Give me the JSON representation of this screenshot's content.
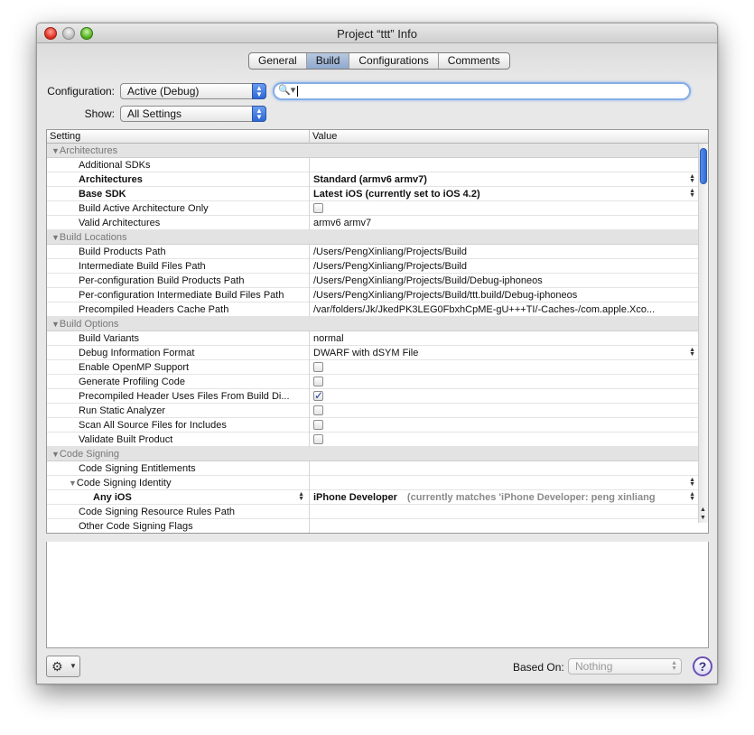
{
  "window": {
    "title": "Project “ttt” Info"
  },
  "tabs": [
    {
      "label": "General"
    },
    {
      "label": "Build",
      "active": true
    },
    {
      "label": "Configurations"
    },
    {
      "label": "Comments"
    }
  ],
  "configuration": {
    "label": "Configuration:",
    "value": "Active (Debug)"
  },
  "show": {
    "label": "Show:",
    "value": "All Settings"
  },
  "search": {
    "value": "",
    "icon": "magnifier-icon"
  },
  "table": {
    "headers": {
      "setting": "Setting",
      "value": "Value"
    },
    "rows": [
      {
        "kind": "group",
        "setting": "Architectures"
      },
      {
        "setting": "Additional SDKs",
        "value": ""
      },
      {
        "setting": "Architectures",
        "value": "Standard (armv6 armv7)",
        "bold": true,
        "stepper": true
      },
      {
        "setting": "Base SDK",
        "value": "Latest iOS (currently set to iOS 4.2)",
        "bold": true,
        "stepper": true
      },
      {
        "setting": "Build Active Architecture Only",
        "checkbox": false
      },
      {
        "setting": "Valid Architectures",
        "value": "armv6 armv7"
      },
      {
        "kind": "group",
        "setting": "Build Locations"
      },
      {
        "setting": "Build Products Path",
        "value": "/Users/PengXinliang/Projects/Build"
      },
      {
        "setting": "Intermediate Build Files Path",
        "value": "/Users/PengXinliang/Projects/Build"
      },
      {
        "setting": "Per-configuration Build Products Path",
        "value": "/Users/PengXinliang/Projects/Build/Debug-iphoneos"
      },
      {
        "setting": "Per-configuration Intermediate Build Files Path",
        "value": "/Users/PengXinliang/Projects/Build/ttt.build/Debug-iphoneos"
      },
      {
        "setting": "Precompiled Headers Cache Path",
        "value": "/var/folders/Jk/JkedPK3LEG0FbxhCpME-gU+++TI/-Caches-/com.apple.Xco..."
      },
      {
        "kind": "group",
        "setting": "Build Options"
      },
      {
        "setting": "Build Variants",
        "value": "normal"
      },
      {
        "setting": "Debug Information Format",
        "value": "DWARF with dSYM File",
        "stepper": true
      },
      {
        "setting": "Enable OpenMP Support",
        "checkbox": false
      },
      {
        "setting": "Generate Profiling Code",
        "checkbox": false
      },
      {
        "setting": "Precompiled Header Uses Files From Build Di...",
        "checkbox": true
      },
      {
        "setting": "Run Static Analyzer",
        "checkbox": false
      },
      {
        "setting": "Scan All Source Files for Includes",
        "checkbox": false
      },
      {
        "setting": "Validate Built Product",
        "checkbox": false
      },
      {
        "kind": "group",
        "setting": "Code Signing"
      },
      {
        "setting": "Code Signing Entitlements",
        "value": ""
      },
      {
        "setting": "Code Signing Identity",
        "value": "",
        "kind": "sub",
        "stepper": true
      },
      {
        "setting": "Any iOS",
        "value": "iPhone Developer",
        "note": "(currently matches 'iPhone Developer: peng xinliang",
        "kind": "subsub",
        "stepper": true,
        "setting_stepper": true
      },
      {
        "setting": "Code Signing Resource Rules Path",
        "value": ""
      },
      {
        "setting": "Other Code Signing Flags",
        "value": ""
      }
    ]
  },
  "footer": {
    "gear_icon": "gear-icon",
    "based_on_label": "Based On:",
    "based_on_value": "Nothing",
    "help_label": "?"
  }
}
